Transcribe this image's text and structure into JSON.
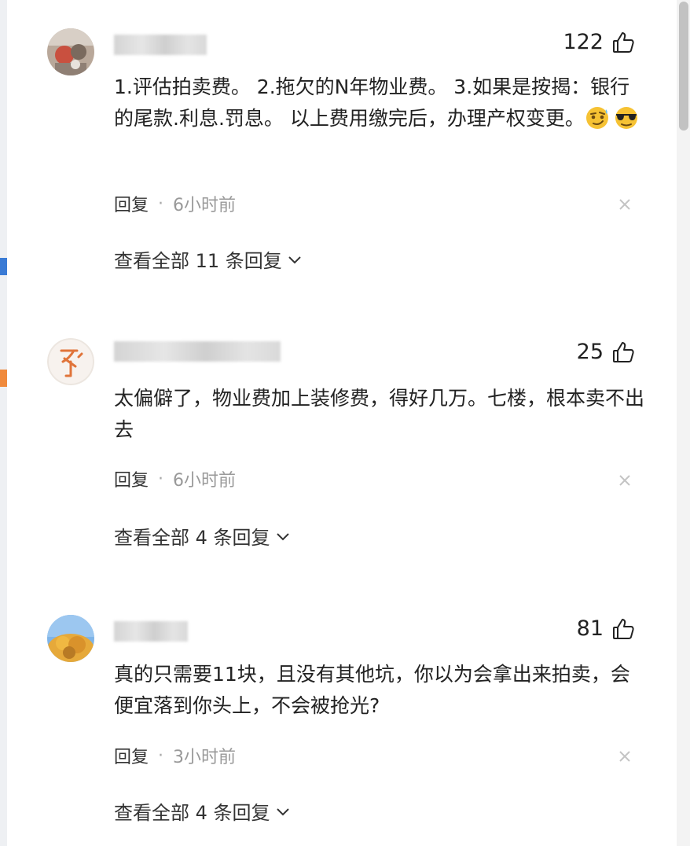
{
  "comments": [
    {
      "likes": "122",
      "text": "1.评估拍卖费。 2.拖欠的N年物业费。 3.如果是按揭：银行的尾款.利息.罚息。 以上费用缴完后，办理产权变更。",
      "emoji": [
        "smirk-face",
        "sunglasses-face"
      ],
      "reply_label": "回复",
      "separator": "·",
      "time": "6小时前",
      "view_all": "查看全部 11 条回复"
    },
    {
      "likes": "25",
      "text": "太偏僻了，物业费加上装修费，得好几万。七楼，根本卖不出去",
      "reply_label": "回复",
      "separator": "·",
      "time": "6小时前",
      "view_all": "查看全部 4 条回复"
    },
    {
      "likes": "81",
      "text": "真的只需要11块，且没有其他坑，你以为会拿出来拍卖，会便宜落到你头上，不会被抢光?",
      "reply_label": "回复",
      "separator": "·",
      "time": "3小时前",
      "view_all": "查看全部 4 条回复"
    }
  ],
  "colors": {
    "text": "#222222",
    "muted": "#999999",
    "scrollbar": "#c2c2c2",
    "edge_blue": "#3a7bd5",
    "edge_orange": "#f08a3c"
  },
  "icons": [
    "thumbs-up-icon",
    "close-icon",
    "chevron-down-icon"
  ]
}
